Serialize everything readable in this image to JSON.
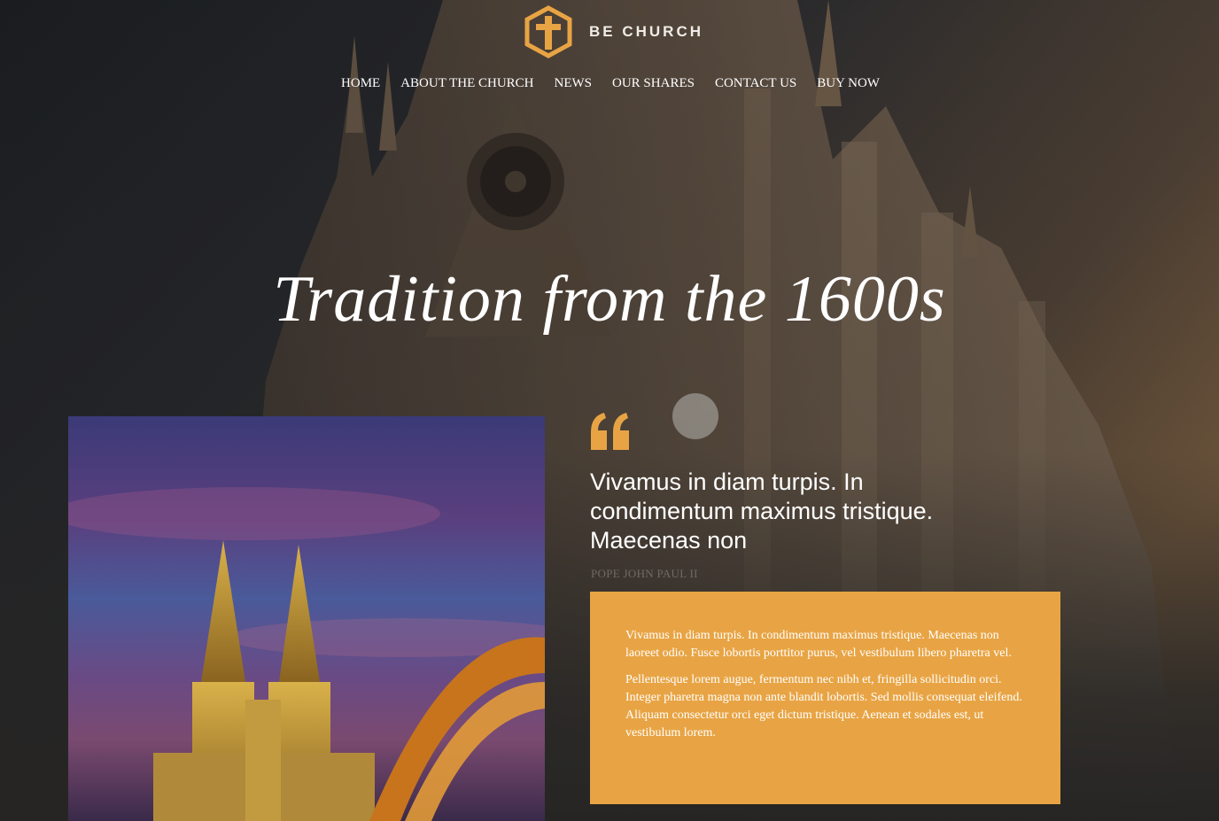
{
  "brand": {
    "name": "BE CHURCH",
    "accent_color": "#e8a444",
    "logo_icon": "cross-hexagon-icon"
  },
  "nav": {
    "items": [
      {
        "label": "HOME"
      },
      {
        "label": "ABOUT THE CHURCH"
      },
      {
        "label": "NEWS"
      },
      {
        "label": "OUR SHARES"
      },
      {
        "label": "CONTACT US"
      },
      {
        "label": "BUY NOW"
      }
    ]
  },
  "hero": {
    "title": "Tradition from the 1600s"
  },
  "quote": {
    "icon": "quote-icon",
    "text": "Vivamus in diam turpis. In condimentum maximus tristique. Maecenas non",
    "author": "POPE JOHN PAUL II"
  },
  "card": {
    "paragraphs": [
      "Vivamus in diam turpis. In condimentum maximus tristique. Maecenas non laoreet odio. Fusce lobortis porttitor purus, vel vestibulum libero pharetra vel.",
      "Pellentesque lorem augue, fermentum nec nibh et, fringilla sollicitudin orci. Integer pharetra magna non ante blandit lobortis. Sed mollis consequat eleifend. Aliquam consectetur orci eget dictum tristique. Aenean et sodales est, ut vestibulum lorem."
    ]
  }
}
